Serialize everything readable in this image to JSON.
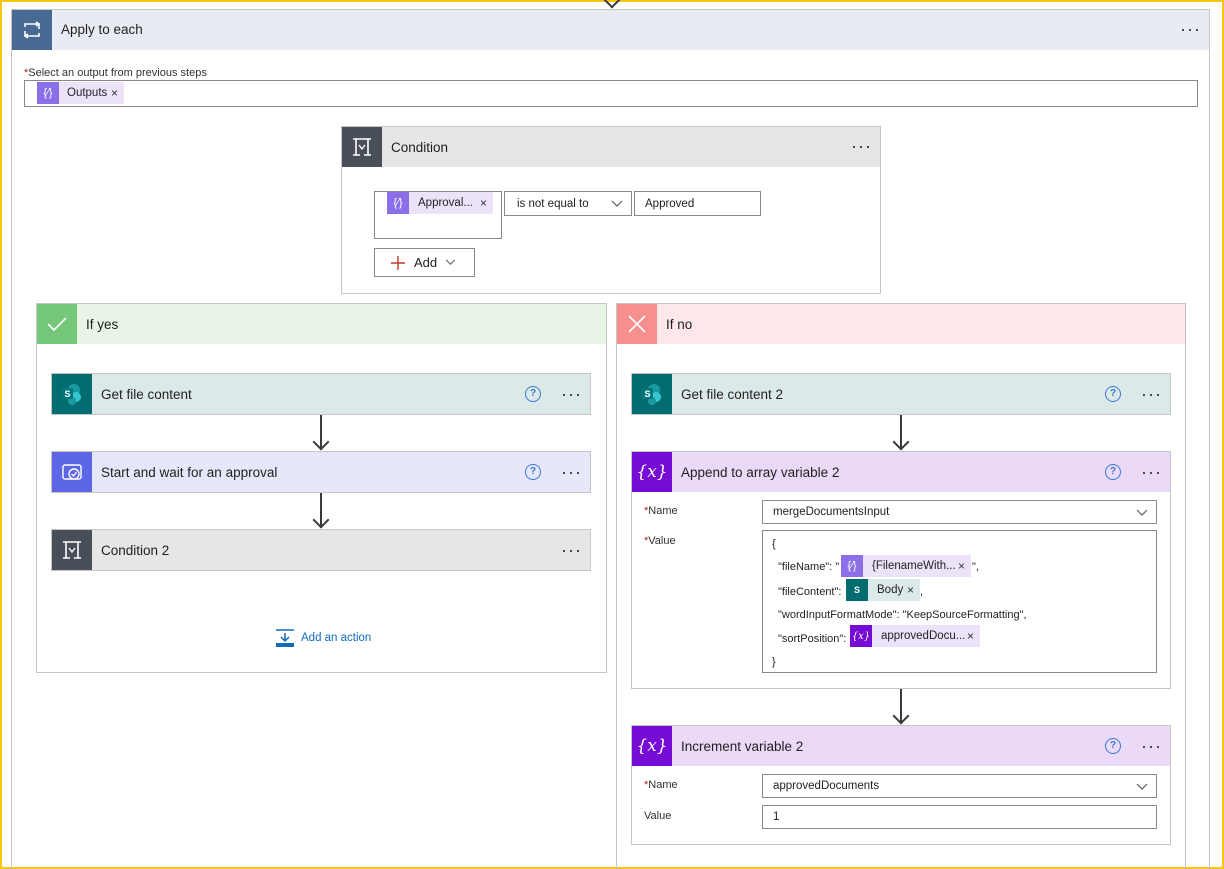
{
  "apply_to_each": {
    "title": "Apply to each",
    "select_label": "Select an output from previous steps",
    "output_token": "Outputs"
  },
  "condition": {
    "title": "Condition",
    "left_token": "Approval...",
    "operator": "is not equal to",
    "value": "Approved",
    "add_label": "Add"
  },
  "if_yes": {
    "title": "If yes",
    "steps": [
      {
        "title": "Get file content"
      },
      {
        "title": "Start and wait for an approval"
      },
      {
        "title": "Condition 2"
      }
    ],
    "add_action_label": "Add an action"
  },
  "if_no": {
    "title": "If no",
    "get_file": {
      "title": "Get file content 2"
    },
    "append": {
      "title": "Append to array variable 2",
      "name_label": "Name",
      "name_value": "mergeDocumentsInput",
      "value_label": "Value",
      "open_brace": "{",
      "filename_key": "\"fileName\": \"",
      "filename_token": "{FilenameWith...",
      "filename_suffix": "\",",
      "filecontent_key": "\"fileContent\":",
      "filecontent_token": "Body",
      "filecontent_suffix": ",",
      "format_line": "\"wordInputFormatMode\": \"KeepSourceFormatting\",",
      "sort_key": "\"sortPosition\":",
      "sort_token": "approvedDocu...",
      "close_brace": "}"
    },
    "increment": {
      "title": "Increment variable 2",
      "name_label": "Name",
      "name_value": "approvedDocuments",
      "value_label": "Value",
      "value": "1"
    }
  },
  "required_mark": "*",
  "colors": {
    "apply_header": "#e8ebf2",
    "apply_icon": "#486991",
    "condition_icon": "#484f58",
    "yes_header": "#e7f4e6",
    "yes_icon": "#75c77c",
    "no_header": "#fde7e9",
    "no_icon": "#f78f8f",
    "sharepoint_header": "#dce9e9",
    "sharepoint_icon": "#036c70",
    "approval_header": "#e6e7fa",
    "approval_icon": "#5c66e6",
    "variable_header": "#ead9f7",
    "variable_icon": "#770bd6"
  }
}
